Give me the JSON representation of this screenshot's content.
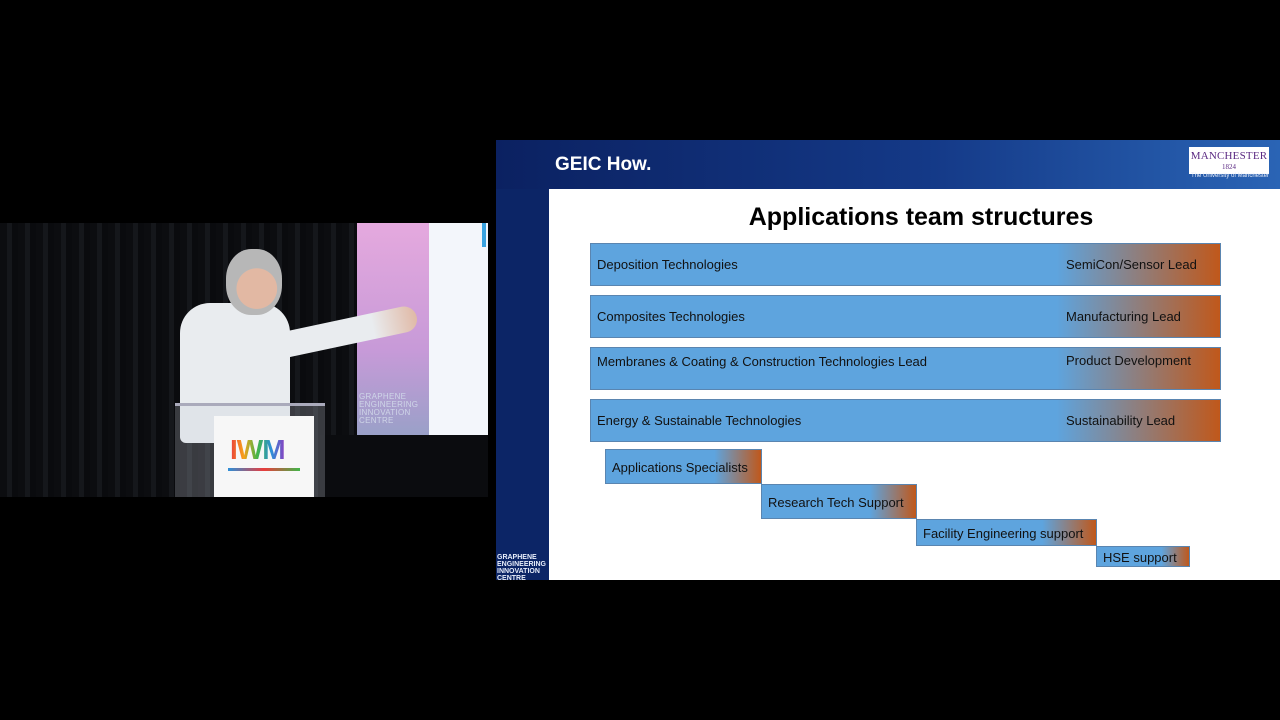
{
  "video": {
    "screen_text": "GRAPHENE ENGINEERING INNOVATION CENTRE",
    "podium_logo": "IWM"
  },
  "slide": {
    "header_title": "GEIC How.",
    "logo_name": "MANCHESTER",
    "logo_year": "1824",
    "logo_sub": "The University of Manchester",
    "corner_mark": "GRAPHENE ENGINEERING INNOVATION CENTRE",
    "title": "Applications team structures",
    "teams": [
      {
        "name": "Deposition Technologies",
        "lead": "SemiCon/Sensor Lead"
      },
      {
        "name": "Composites Technologies",
        "lead": "Manufacturing Lead"
      },
      {
        "name": "Membranes & Coating & Construction Technologies Lead",
        "lead": "Product Development"
      },
      {
        "name": "Energy & Sustainable Technologies",
        "lead": "Sustainability Lead"
      }
    ],
    "supports": [
      {
        "label": "Applications Specialists"
      },
      {
        "label": "Research Tech Support"
      },
      {
        "label": "Facility Engineering support"
      },
      {
        "label": "HSE support"
      }
    ]
  }
}
